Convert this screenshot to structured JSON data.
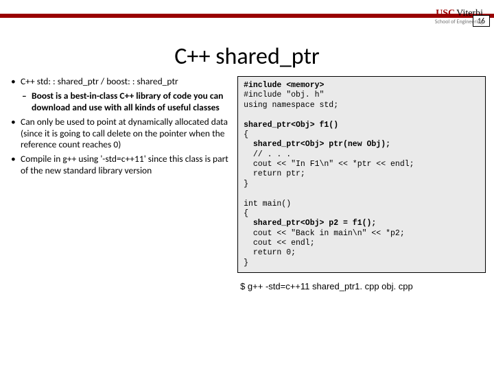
{
  "page_number": "16",
  "logo": {
    "usc": "USC",
    "viterbi": "Viterbi",
    "sub": "School of Engineering"
  },
  "title": "C++ shared_ptr",
  "bullets": {
    "b1": "C++ std: : shared_ptr / boost: : shared_ptr",
    "b1a": "Boost is a best-in-class C++ library of code you can download and use with all kinds of useful classes",
    "b2": "Can only be used to point at dynamically allocated data (since it is going to call delete on the pointer when the reference count reaches 0)",
    "b3": "Compile in g++ using '-std=c++11' since this class is part of the new standard library version"
  },
  "code": {
    "l1": "#include <memory>",
    "l2": "#include \"obj. h\"",
    "l3": "using namespace std;",
    "l4": "",
    "l5": "shared_ptr<Obj> f1()",
    "l6": "{",
    "l7": "  shared_ptr<Obj> ptr(new Obj);",
    "l8": "  // . . .",
    "l9": "  cout << \"In F1\\n\" << *ptr << endl;",
    "l10": "  return ptr;",
    "l11": "}",
    "l12": "",
    "l13": "int main()",
    "l14": "{",
    "l15": "  shared_ptr<Obj> p2 = f1();",
    "l16": "  cout << \"Back in main\\n\" << *p2;",
    "l17": "  cout << endl;",
    "l18": "  return 0;",
    "l19": "}"
  },
  "command": "$ g++ -std=c++11 shared_ptr1. cpp obj. cpp"
}
